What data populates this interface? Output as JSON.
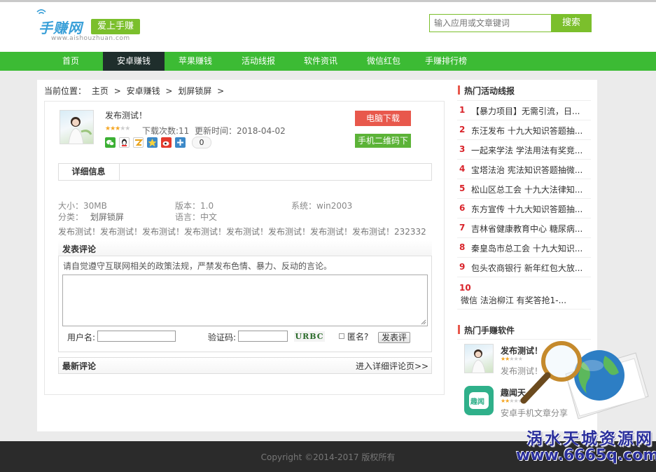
{
  "header": {
    "logo_text": "手赚网",
    "logo_badge": "爱上手赚",
    "logo_url": "www.aishouzhuan.com",
    "search_placeholder": "输入应用或文章键词",
    "search_button": "搜索"
  },
  "nav": {
    "items": [
      "首页",
      "安卓赚钱",
      "苹果赚钱",
      "活动线报",
      "软件资讯",
      "微信红包",
      "手赚排行榜"
    ],
    "active_index": 1
  },
  "breadcrumb": {
    "prefix": "当前位置：",
    "items": [
      "主页",
      "安卓赚钱",
      "划屏锁屏"
    ],
    "separator": ">"
  },
  "app": {
    "title": "发布测试！",
    "rating": 3,
    "rating_max": 5,
    "downloads": "下载次数:11",
    "update_time": "更新时间：2018-04-02",
    "share_count": "0",
    "share_icons": [
      "wechat-icon",
      "qq-icon",
      "qzone-icon",
      "star-share-icon",
      "weibo-icon",
      "plus-share-icon"
    ],
    "btn_pc": "电脑下载",
    "btn_qr": "手机二维码下"
  },
  "detail": {
    "tab": "详细信息",
    "size": "大小：30MB",
    "version": "版本：1.0",
    "system": "系统：win2003",
    "category_label": "分类：",
    "category": "划屏锁屏",
    "language": "语言：中文",
    "description": "发布测试！发布测试！发布测试！发布测试！发布测试！发布测试！发布测试！发布测试！232332"
  },
  "comment": {
    "title": "发表评论",
    "note": "请自觉遵守互联网相关的政策法规，严禁发布色情、暴力、反动的言论。",
    "username_label": "用户名:",
    "captcha_label": "验证码:",
    "captcha_image_text": "URBC",
    "anonymous_label": "匿名?",
    "submit": "发表评"
  },
  "latest": {
    "title": "最新评论",
    "link": "进入详细评论页>>"
  },
  "sidebar": {
    "hot_news_title": "热门活动线报",
    "hot_news": [
      {
        "num": "1",
        "text": "【暴力项目】无需引流，日..."
      },
      {
        "num": "2",
        "text": "东汪发布 十九大知识答题抽..."
      },
      {
        "num": "3",
        "text": "一起来学法 学法用法有奖竞..."
      },
      {
        "num": "4",
        "text": "宝塔法治 宪法知识答题抽微..."
      },
      {
        "num": "5",
        "text": "松山区总工会 十九大法律知..."
      },
      {
        "num": "6",
        "text": "东方宣传 十九大知识答题抽..."
      },
      {
        "num": "7",
        "text": "吉林省健康教育中心 糖尿病..."
      },
      {
        "num": "8",
        "text": "秦皇岛市总工会 十九大知识..."
      },
      {
        "num": "9",
        "text": "包头农商银行 新年红包大放..."
      },
      {
        "num": "10",
        "text": "微信 法治柳江 有奖答抢1-..."
      }
    ],
    "hot_soft_title": "热门手赚软件",
    "hot_soft": [
      {
        "title": "发布测试！",
        "desc": "发布测试！",
        "rating": 2
      },
      {
        "title": "趣闻天",
        "desc": "安卓手机文章分享",
        "rating": 2,
        "icon_text": "趣闻"
      }
    ]
  },
  "footer": {
    "copyright": "Copyright ©2014-2017 版权所有"
  },
  "watermark": {
    "title": "涡水天城资源网",
    "url": "www.6665q.com"
  },
  "colors": {
    "nav_green": "#3cbb34",
    "nav_active": "#1f2e2c",
    "brand_green": "#7bbf2c",
    "btn_red": "#e8584c",
    "btn_green": "#5cb338",
    "rank_red": "#d9232a"
  }
}
